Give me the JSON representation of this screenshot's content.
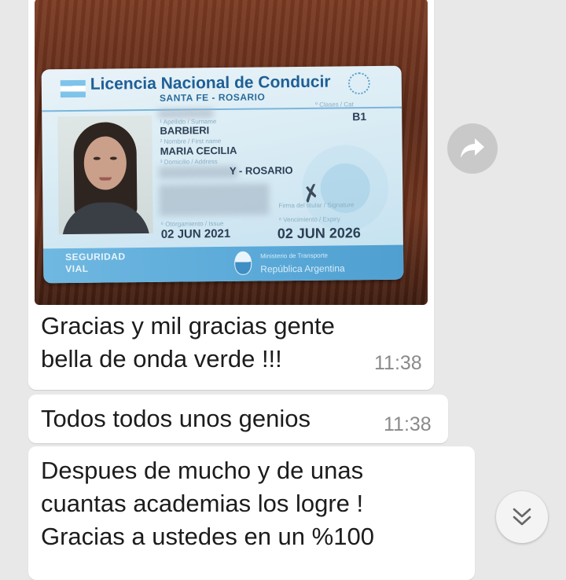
{
  "license": {
    "title": "Licencia Nacional de Conducir",
    "subtitle": "SANTA FE - ROSARIO",
    "clases_label": "º Clases / Cat",
    "class_value": "B1",
    "apellido_label": "¹ Apellido / Surname",
    "surname": "BARBIERI",
    "nombre_label": "² Nombre / First name",
    "first_name": "MARIA CECILIA",
    "domicilio_label": "³ Domicilio / Address",
    "address_visible": "Y - ROSARIO",
    "otorgamiento_label": "⁶ Otorgamiento / Issue",
    "issue_date": "02 JUN 2021",
    "vencimiento_label": "⁸ Vencimiento / Expiry",
    "expiry_date": "02 JUN 2026",
    "firma_label": "Firma del titular / Signature",
    "seguridad_line1": "SEGURIDAD",
    "seguridad_line2": "VIAL",
    "ministerio": "Ministerio de Transporte",
    "republica": "República Argentina"
  },
  "messages": [
    {
      "lines": [
        "Gracias y mil gracias gente",
        "bella de onda verde !!!"
      ],
      "time": "11:38"
    },
    {
      "lines": [
        "Todos todos unos genios"
      ],
      "time": "11:38"
    },
    {
      "lines": [
        "Despues de mucho y de unas",
        "cuantas academias los logre !",
        "Gracias a ustedes en un %100"
      ]
    }
  ],
  "icons": {
    "forward": "forward-arrow-icon",
    "scroll": "double-chevron-down-icon"
  },
  "colors": {
    "background": "#e8e8e8",
    "bubble": "#ffffff",
    "timestamp": "#8a8a8a"
  }
}
